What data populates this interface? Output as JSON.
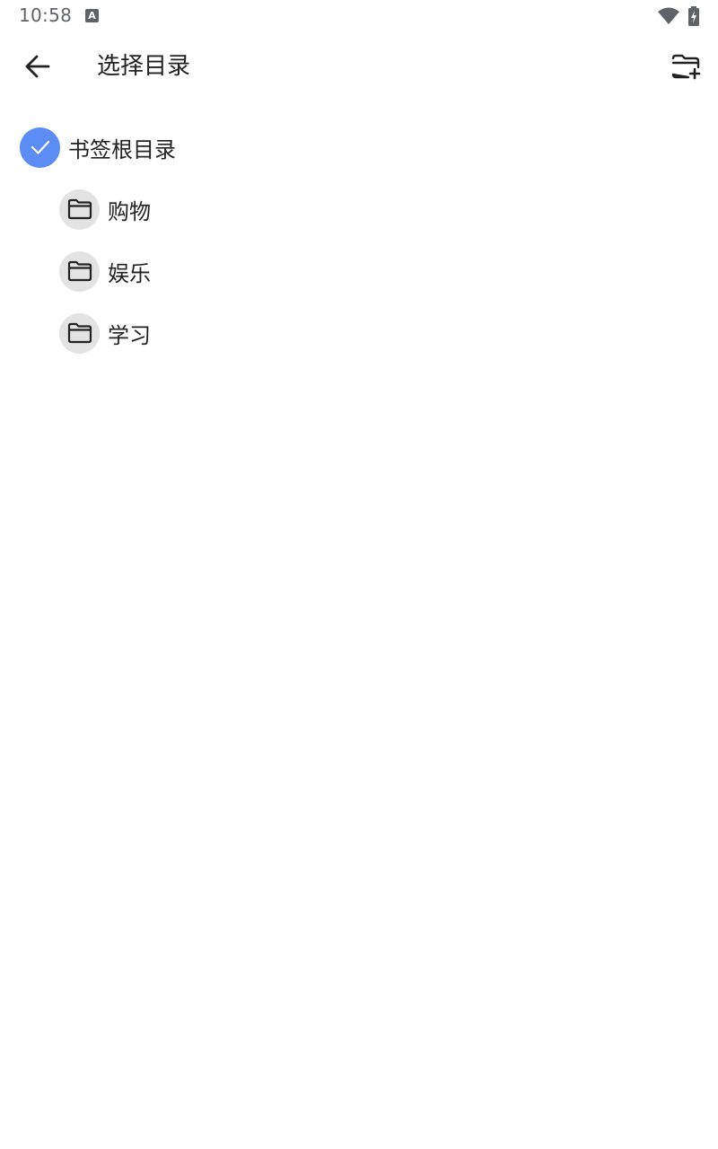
{
  "status_bar": {
    "time": "10:58",
    "notification_icon": "a-icon",
    "wifi_icon": "wifi-icon",
    "battery_icon": "battery-charging-icon"
  },
  "toolbar": {
    "back_icon": "arrow-back-icon",
    "title": "选择目录",
    "action_icon": "folder-add-icon"
  },
  "tree": {
    "root": {
      "label": "书签根目录",
      "selected": true,
      "icon": "check-icon"
    },
    "children": [
      {
        "label": "购物",
        "icon": "folder-icon"
      },
      {
        "label": "娱乐",
        "icon": "folder-icon"
      },
      {
        "label": "学习",
        "icon": "folder-icon"
      }
    ]
  },
  "colors": {
    "accent": "#5b8df5",
    "folder_bg": "#e3e3e3",
    "text": "#222222",
    "status_text": "#5f6368"
  }
}
